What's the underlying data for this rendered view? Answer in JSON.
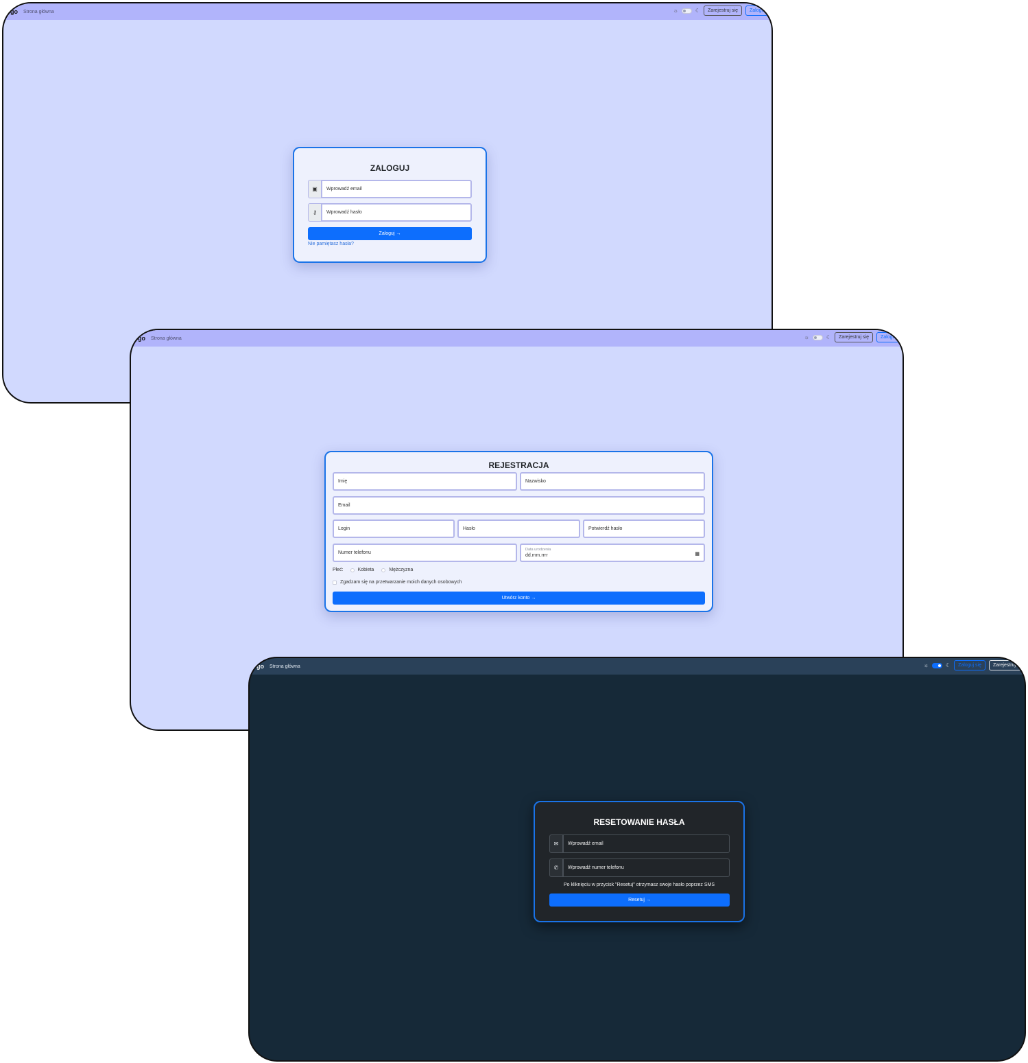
{
  "login_screen": {
    "nav": {
      "brand": "go",
      "home": "Strona główna",
      "sun_icon": "☼",
      "moon_icon": "☾",
      "register": "Zarejestruj się",
      "login": "Zaloguj"
    },
    "title": "ZALOGUJ",
    "email_placeholder": "Wprowadź email",
    "password_placeholder": "Wprowadź hasło",
    "email_icon": "▣",
    "key_icon": "⚷",
    "submit": "Zaloguj →",
    "forgot": "Nie pamiętasz hasła?"
  },
  "register_screen": {
    "nav": {
      "brand": "go",
      "home": "Strona główna",
      "sun_icon": "☼",
      "moon_icon": "☾",
      "register": "Zarejestruj się",
      "login": "Zaloguj"
    },
    "title": "REJESTRACJA",
    "first_name": "Imię",
    "last_name": "Nazwisko",
    "email": "Email",
    "login": "Login",
    "password": "Hasło",
    "confirm_password": "Potwierdź hasło",
    "phone": "Numer telefonu",
    "birthdate_label": "Data urodzenia",
    "birthdate_value": "dd.mm.rrrr",
    "calendar_icon": "▦",
    "gender_label": "Płeć:",
    "gender_female": "Kobieta",
    "gender_male": "Mężczyzna",
    "consent": "Zgadzam się na przetwarzanie moich danych osobowych",
    "submit": "Utwórz konto →"
  },
  "reset_screen": {
    "nav": {
      "brand": "go",
      "home": "Strona główna",
      "sun_icon": "☼",
      "moon_icon": "☾",
      "login": "Zaloguj się",
      "register": "Zarejestruj się"
    },
    "title": "RESETOWANIE HASŁA",
    "email_placeholder": "Wprowadź email",
    "phone_placeholder": "Wprowadź numer telefonu",
    "mail_icon": "✉",
    "phone_icon": "✆",
    "info": "Po kliknięciu w przycisk \"Resetuj\" otrzymasz swoje hasło poprzez SMS",
    "submit": "Resetuj →"
  },
  "colors": {
    "light_background": "#d1d9fe",
    "light_navbar": "#b1b4fb",
    "dark_background": "#162938",
    "dark_navbar": "#2a4159",
    "primary": "#0d6efd",
    "card_border": "#1a73e8"
  }
}
